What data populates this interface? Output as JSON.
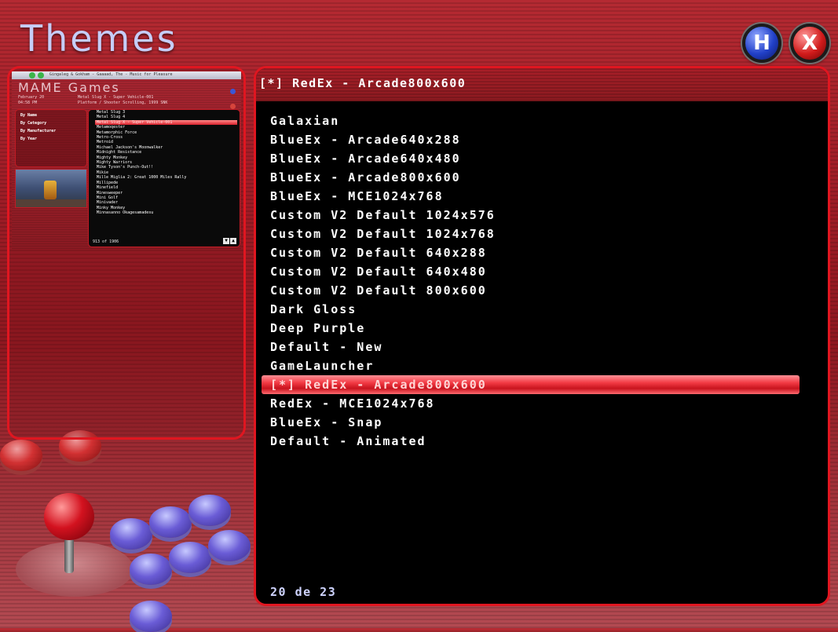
{
  "window": {
    "title": "Themes"
  },
  "buttons": {
    "help_label": "H",
    "close_label": "X"
  },
  "preview": {
    "topbar_text": "Gingaleg & Gokham - Gaaaad, The - Music for Pleasure",
    "title": "MAME Games",
    "date_line1": "February 20",
    "date_line2": "04:58 PM",
    "game_line1": "Metal Slug X - Super Vehicle-001",
    "game_line2": "Platform / Shooter Scrolling, 1999 SNK",
    "menu": [
      "By Name",
      "By Category",
      "By Manufacturer",
      "By Year"
    ],
    "games": [
      "Metal Slug 3",
      "Metal Slug 4",
      "Metal Slug X - Super Vehicle-001",
      "Metamoqester",
      "Metamorphic Force",
      "Metro-Cross",
      "Metroid",
      "Michael Jackson's Moonwalker",
      "Midnight Resistance",
      "Mighty Monkey",
      "Mighty Warriors",
      "Mike Tyson's Punch-Out!!",
      "Mikie",
      "Mille Miglia 2: Great 1000 Miles Rally",
      "Millipede",
      "Minefield",
      "Minesweeper",
      "Mini Golf",
      "Minivader",
      "Minky Monkey",
      "Minnasanno Okagesamadesu"
    ],
    "selected_game_index": 2,
    "count": "913 of 1906"
  },
  "theme_list": {
    "header": "[*] RedEx - Arcade800x600",
    "items": [
      "Galaxian",
      "BlueEx - Arcade640x288",
      "BlueEx - Arcade640x480",
      "BlueEx - Arcade800x600",
      "BlueEx - MCE1024x768",
      "Custom V2 Default 1024x576",
      "Custom V2 Default 1024x768",
      "Custom V2 Default 640x288",
      "Custom V2 Default 640x480",
      "Custom V2 Default 800x600",
      "Dark Gloss",
      "Deep Purple",
      "Default - New",
      "GameLauncher",
      "[*] RedEx - Arcade800x600",
      "RedEx - MCE1024x768",
      "BlueEx - Snap",
      "Default - Animated"
    ],
    "selected_index": 14,
    "count": "20 de 23"
  },
  "colors": {
    "accent": "#e01620",
    "title": "#c6cdf8",
    "count": "#cfd4ff",
    "help": "#2140c8",
    "close": "#d11b1b"
  }
}
